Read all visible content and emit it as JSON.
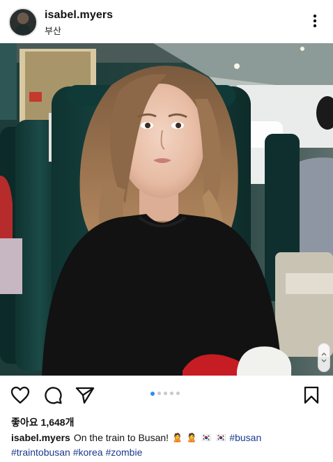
{
  "post": {
    "username": "isabel.myers",
    "location": "부산",
    "likes_text": "좋아요 1,648개",
    "caption": {
      "username": "isabel.myers",
      "text": "On the train to Busan!",
      "emoji_1": "🙎",
      "emoji_2": "🙎",
      "emoji_3": "🇰🇷",
      "emoji_4": "🇰🇷",
      "tags": [
        "#busan",
        "#traintobusan",
        "#korea",
        "#zombie"
      ]
    },
    "carousel": {
      "count": 5,
      "active_index": 0
    }
  },
  "icons": {
    "more": "more-vertical-icon",
    "like": "heart-icon",
    "comment": "comment-icon",
    "share": "send-icon",
    "save": "bookmark-icon"
  },
  "colors": {
    "accent_blue": "#2d8cf0",
    "hashtag": "#1d3a8a"
  }
}
